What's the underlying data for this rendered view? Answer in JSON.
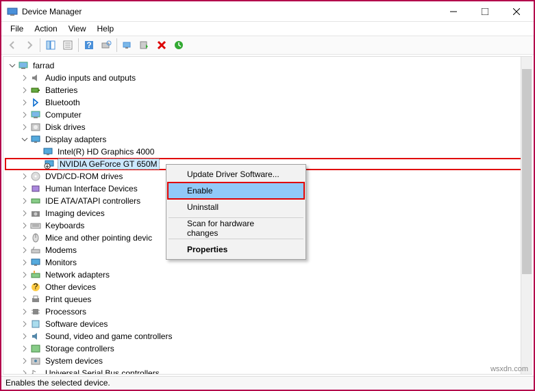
{
  "window": {
    "title": "Device Manager"
  },
  "menu": {
    "file": "File",
    "action": "Action",
    "view": "View",
    "help": "Help"
  },
  "tree": {
    "root": "farrad",
    "items": [
      {
        "label": "Audio inputs and outputs",
        "icon": "audio"
      },
      {
        "label": "Batteries",
        "icon": "battery"
      },
      {
        "label": "Bluetooth",
        "icon": "bluetooth"
      },
      {
        "label": "Computer",
        "icon": "computer"
      },
      {
        "label": "Disk drives",
        "icon": "disk"
      }
    ],
    "display": {
      "label": "Display adapters",
      "children": [
        {
          "label": "Intel(R) HD Graphics 4000",
          "icon": "monitor"
        },
        {
          "label": "NVIDIA GeForce GT 650M",
          "icon": "monitor-down",
          "selected": true
        }
      ]
    },
    "after": [
      {
        "label": "DVD/CD-ROM drives",
        "icon": "disc"
      },
      {
        "label": "Human Interface Devices",
        "icon": "hid"
      },
      {
        "label": "IDE ATA/ATAPI controllers",
        "icon": "ide"
      },
      {
        "label": "Imaging devices",
        "icon": "camera"
      },
      {
        "label": "Keyboards",
        "icon": "keyboard"
      },
      {
        "label": "Mice and other pointing devic",
        "icon": "mouse",
        "cut": true
      },
      {
        "label": "Modems",
        "icon": "modem"
      },
      {
        "label": "Monitors",
        "icon": "monitor"
      },
      {
        "label": "Network adapters",
        "icon": "net"
      },
      {
        "label": "Other devices",
        "icon": "unknown"
      },
      {
        "label": "Print queues",
        "icon": "printer"
      },
      {
        "label": "Processors",
        "icon": "cpu"
      },
      {
        "label": "Software devices",
        "icon": "soft"
      },
      {
        "label": "Sound, video and game controllers",
        "icon": "sound"
      },
      {
        "label": "Storage controllers",
        "icon": "storage"
      },
      {
        "label": "System devices",
        "icon": "system"
      },
      {
        "label": "Universal Serial Bus controllers",
        "icon": "usb",
        "cut": true
      }
    ]
  },
  "context": {
    "update": "Update Driver Software...",
    "enable": "Enable",
    "uninstall": "Uninstall",
    "scan": "Scan for hardware changes",
    "properties": "Properties"
  },
  "status": "Enables the selected device.",
  "watermark": "wsxdn.com"
}
